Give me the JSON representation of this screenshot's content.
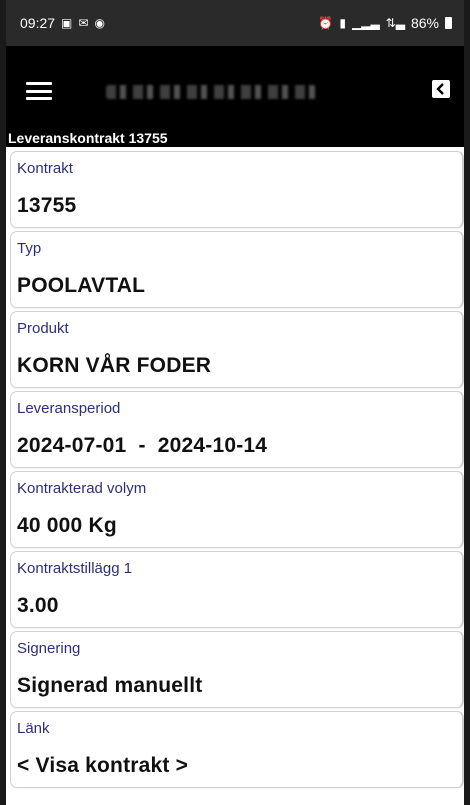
{
  "status_bar": {
    "time": "09:27",
    "battery": "86%",
    "icons_left": [
      "gallery-icon",
      "sms-icon",
      "whatsapp-icon"
    ],
    "icons_right": [
      "alarm-icon",
      "vibrate-icon",
      "signal-icon",
      "data-signal-icon",
      "battery-icon"
    ]
  },
  "header": {
    "page_title": "Leveranskontrakt 13755",
    "menu_icon": "hamburger-menu-icon",
    "back_icon": "back-arrow-icon"
  },
  "fields": [
    {
      "label": "Kontrakt",
      "value": "13755"
    },
    {
      "label": "Typ",
      "value": "POOLAVTAL"
    },
    {
      "label": "Produkt",
      "value": "KORN VÅR FODER"
    },
    {
      "label": "Leveransperiod",
      "value": "2024-07-01  -  2024-10-14"
    },
    {
      "label": "Kontrakterad volym",
      "value": "40 000 Kg"
    },
    {
      "label": "Kontraktstillägg 1",
      "value": "3.00"
    },
    {
      "label": "Signering",
      "value": "Signerad manuellt"
    },
    {
      "label": "Länk",
      "value": "< Visa kontrakt >"
    }
  ],
  "colors": {
    "label": "#2e2e7a",
    "value": "#111111",
    "header_bg": "#000000",
    "status_bg": "#2a2a2a"
  }
}
